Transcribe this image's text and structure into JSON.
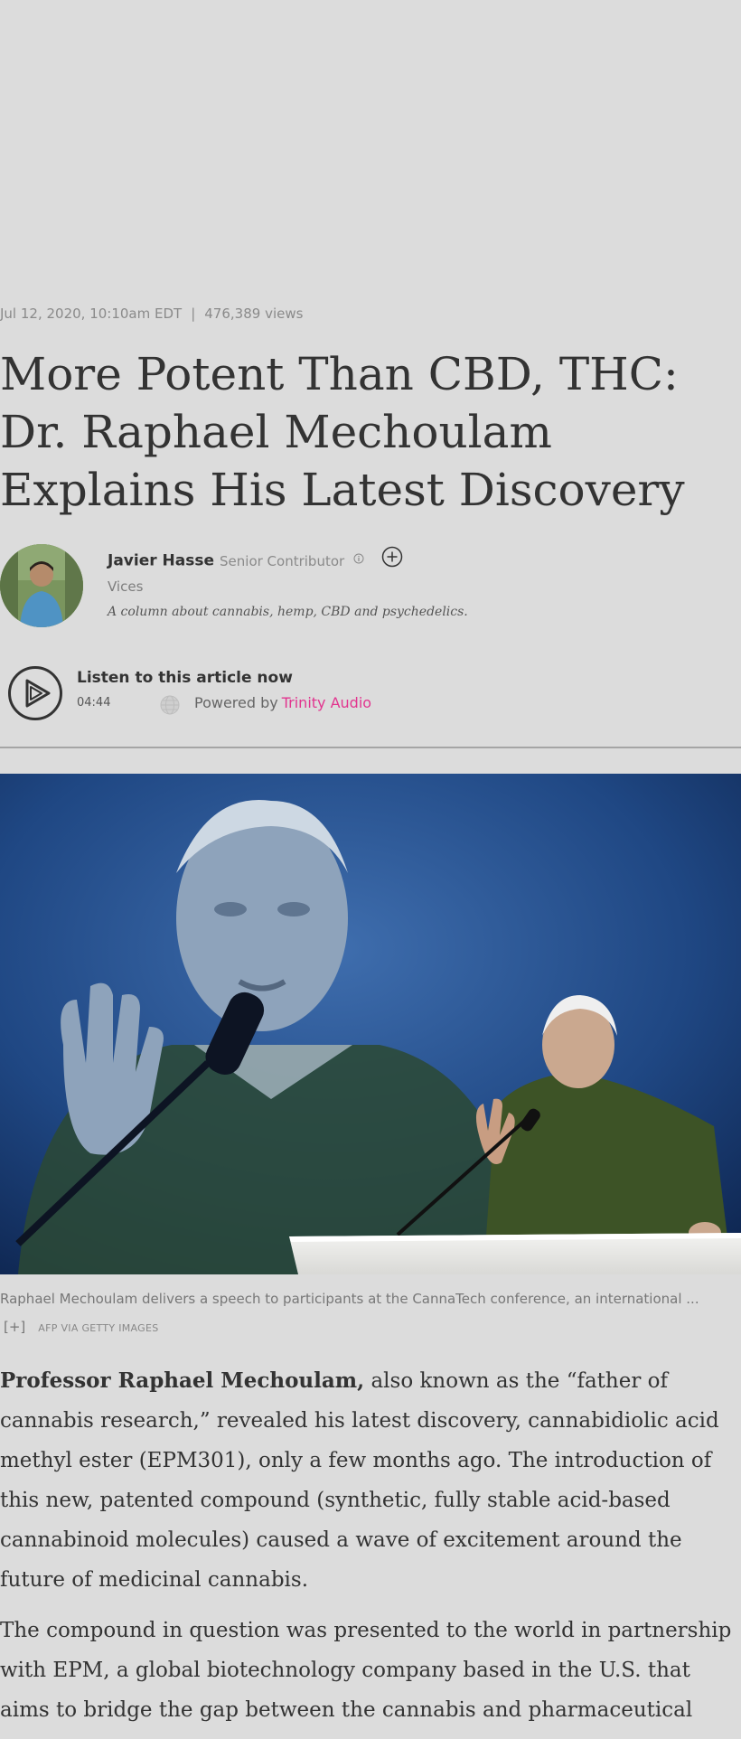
{
  "article": {
    "date": "Jul 12, 2020, 10:10am EDT",
    "separator": "|",
    "views": "476,389 views",
    "headline": "More Potent Than CBD, THC: Dr. Raphael Mechoulam Explains His Latest Discovery",
    "author": {
      "name": "Javier Hasse",
      "role": "Senior Contributor",
      "section": "Vices",
      "column_description": "A column about cannabis, hemp, CBD and psychedelics."
    },
    "audio": {
      "title": "Listen to this article now",
      "duration": "04:44",
      "powered_by": "Powered by",
      "provider": "Trinity Audio"
    },
    "image": {
      "caption": "Raphael Mechoulam delivers a speech to participants at the CannaTech conference, an international ...",
      "expand_label": "[+]",
      "credit": "AFP VIA GETTY IMAGES"
    },
    "body": {
      "p1_bold": "Professor Raphael Mechoulam,",
      "p1_rest": " also known as the “father of cannabis research,” revealed his latest discovery, cannabidiolic acid methyl ester (EPM301), only a few months ago. The introduction of this new, patented compound (synthetic, fully stable acid-based cannabinoid molecules) caused a wave of excitement around the future of medicinal cannabis.",
      "p2": "The compound in question was presented to the world in partnership with EPM, a global biotechnology company based in the U.S. that aims to bridge the gap between the cannabis and pharmaceutical"
    }
  },
  "icons": {
    "info": "info-icon",
    "follow": "plus-circle-icon",
    "play": "play-circle-icon",
    "globe": "globe-icon"
  },
  "colors": {
    "background": "#dcdcdc",
    "brand_pink": "#e2358f",
    "headline": "#333333",
    "meta": "#8a8a8a"
  }
}
